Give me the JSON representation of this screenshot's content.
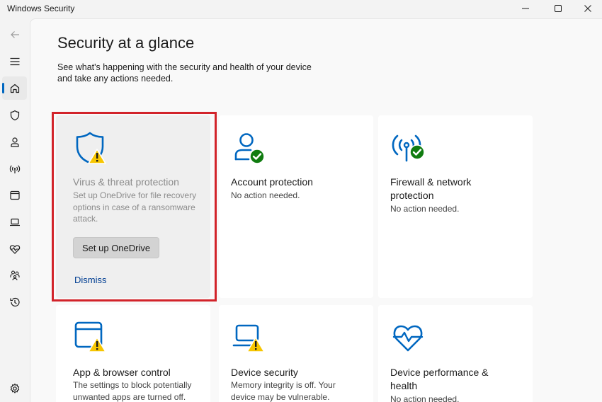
{
  "window": {
    "title": "Windows Security"
  },
  "page": {
    "title": "Security at a glance",
    "description": "See what's happening with the security and health of your device and take any actions needed."
  },
  "tiles": [
    {
      "title": "Virus & threat protection",
      "desc": "Set up OneDrive for file recovery options in case of a ransomware attack.",
      "button": "Set up OneDrive",
      "link": "Dismiss",
      "status": "warning"
    },
    {
      "title": "Account protection",
      "desc": "No action needed.",
      "status": "ok"
    },
    {
      "title": "Firewall & network protection",
      "desc": "No action needed.",
      "status": "ok"
    },
    {
      "title": "App & browser control",
      "desc": "The settings to block potentially unwanted apps are turned off.",
      "status": "warning"
    },
    {
      "title": "Device security",
      "desc": "Memory integrity is off. Your device may be vulnerable.",
      "status": "warning"
    },
    {
      "title": "Device performance & health",
      "desc": "No action needed.",
      "status": "ok"
    }
  ],
  "colors": {
    "accent": "#0067c0",
    "ok": "#107c10",
    "warning": "#f7c600",
    "highlight": "#d2232a"
  }
}
